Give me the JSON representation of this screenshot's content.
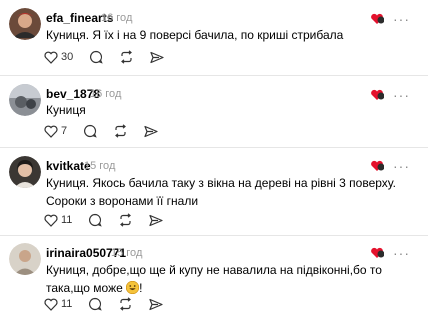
{
  "posts": [
    {
      "username": "efa_finearts",
      "time": "16 год",
      "text": "Куниця. Я їх і на 9 поверсі бачила, по криші стрибала",
      "likes": "30"
    },
    {
      "username": "bev_1878",
      "time": "16 год",
      "text": "Куниця",
      "likes": "7"
    },
    {
      "username": "kvitkate",
      "time": "15 год",
      "text": "Куниця. Якось бачила таку з вікна на дереві на рівні 3 поверху. Сороки з воронами її гнали",
      "likes": "11"
    },
    {
      "username": "irinaira050771",
      "time": "15 год",
      "text": "Куниця, добре,що ще й купу не навалила на підвіконні,бо то така,що може",
      "text_suffix": "!",
      "likes": "11"
    }
  ],
  "icons": {
    "like": "heart-outline-icon",
    "comment": "speech-bubble-icon",
    "repost": "repost-icon",
    "share": "send-icon",
    "creator_like": "heart-avatar-icon",
    "more": "more-icon",
    "emoji": "grinning-face-icon"
  },
  "colors": {
    "heart_red": "#e4122d",
    "muted": "#9a9a9a",
    "divider": "#e6e6e6"
  }
}
